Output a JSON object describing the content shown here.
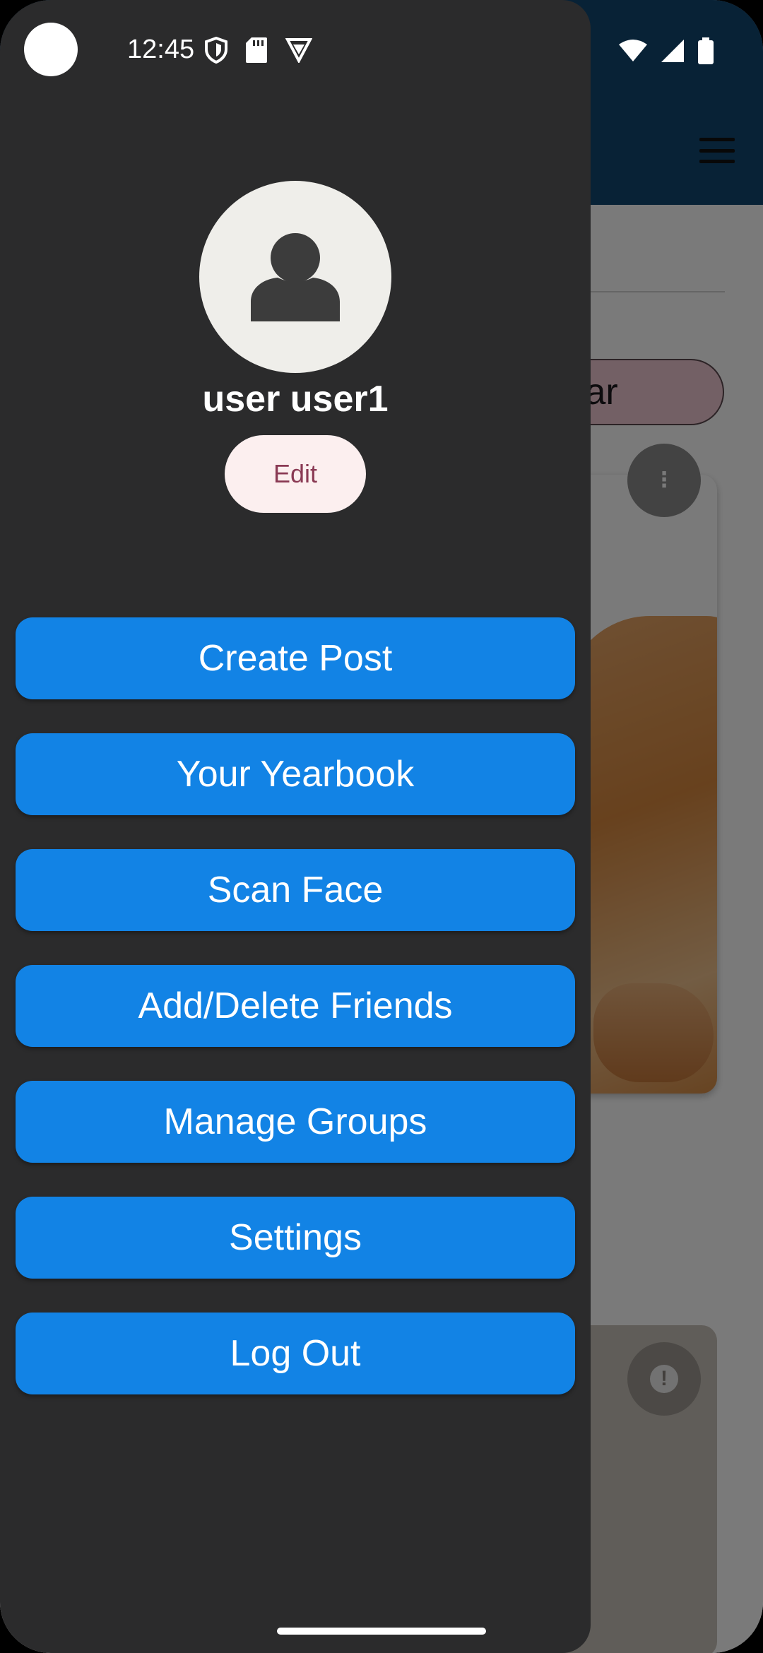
{
  "status_bar": {
    "time": "12:45",
    "left_icons": [
      "shield-icon",
      "sd-card-icon",
      "vpn-icon"
    ],
    "right_icons": [
      "wifi-icon",
      "signal-icon",
      "battery-icon"
    ]
  },
  "drawer": {
    "user_name": "user user1",
    "edit_label": "Edit",
    "menu": [
      {
        "label": "Create Post"
      },
      {
        "label": "Your Yearbook"
      },
      {
        "label": "Scan Face"
      },
      {
        "label": "Add/Delete Friends"
      },
      {
        "label": "Manage Groups"
      },
      {
        "label": "Settings"
      },
      {
        "label": "Log Out"
      }
    ]
  },
  "background": {
    "chip_text": "ular",
    "menu_icon": "hamburger-icon"
  },
  "colors": {
    "drawer_bg": "#2b2b2c",
    "button_blue": "#1283e5",
    "app_bar": "#124772",
    "edit_bg": "#fcefef",
    "edit_text": "#8a3a54"
  }
}
